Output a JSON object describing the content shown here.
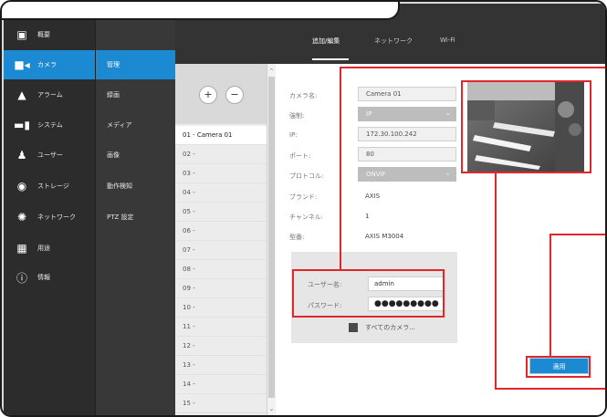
{
  "nav": {
    "main": [
      {
        "label": "概要",
        "icon": "dashboard-icon"
      },
      {
        "label": "カメラ",
        "icon": "camera-icon"
      },
      {
        "label": "アラーム",
        "icon": "alarm-icon"
      },
      {
        "label": "システム",
        "icon": "system-icon"
      },
      {
        "label": "ユーザー",
        "icon": "user-icon"
      },
      {
        "label": "ストレージ",
        "icon": "storage-icon"
      },
      {
        "label": "ネットワーク",
        "icon": "network-icon"
      },
      {
        "label": "用途",
        "icon": "apps-icon"
      },
      {
        "label": "情報",
        "icon": "info-icon"
      }
    ],
    "sub": [
      "管理",
      "録画",
      "メディア",
      "画像",
      "動作検知",
      "PTZ 設定"
    ]
  },
  "tabs": [
    "追加/編集",
    "ネットワーク",
    "Wi-Fi"
  ],
  "camera_list": {
    "add_label": "+",
    "remove_label": "−",
    "rows": [
      "01 - Camera 01",
      "02 -",
      "03 -",
      "04 -",
      "05 -",
      "06 -",
      "07 -",
      "08 -",
      "09 -",
      "10 -",
      "11 -",
      "12 -",
      "13 -",
      "14 -",
      "15 -"
    ]
  },
  "form": {
    "camera_name_label": "カメラ名:",
    "camera_name_value": "Camera 01",
    "protocol_mode_label": "強制:",
    "protocol_mode_value": "IP",
    "ip_label": "IP:",
    "ip_value": "172.30.100.242",
    "port_label": "ポート:",
    "port_value": "80",
    "protocol_label": "プロトコル:",
    "protocol_value": "ONVIF",
    "brand_label": "ブランド:",
    "brand_value": "AXIS",
    "channel_label": "チャンネル:",
    "channel_value": "1",
    "model_label": "型番:",
    "model_value": "AXIS M3004",
    "username_label": "ユーザー名:",
    "username_value": "admin",
    "password_label": "パスワード:",
    "password_value": "●●●●●●●●●",
    "all_cameras_label": "すべてのカメラ..."
  },
  "apply_label": "適用",
  "colors": {
    "accent": "#1b8ad3",
    "callout_red": "#e1272c",
    "nav_bg": "#2c2c2c"
  }
}
